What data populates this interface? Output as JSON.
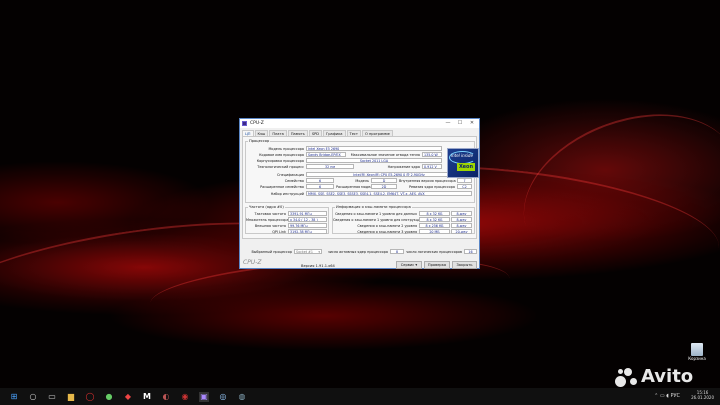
{
  "window": {
    "title": "CPU-Z",
    "controls": [
      "—",
      "☐",
      "✕"
    ],
    "tabs": [
      "ЦП",
      "Кэш",
      "Плата",
      "Память",
      "SPD",
      "Графика",
      "Тест",
      "О программе"
    ],
    "active_tab": "ЦП",
    "processor": {
      "group_label": "Процессор",
      "model_label": "Модель процессора",
      "model": "Intel Xeon E5 2690",
      "codename_label": "Кодовое имя процессора",
      "codename": "Sandy Bridge-EP/EX",
      "tdp_label": "Максимальное значение отвода тепла",
      "tdp": "135.0 W",
      "package_label": "Корпусировка процессора",
      "package": "Socket 2011 LGA",
      "tech_label": "Технологический процесс",
      "tech": "32 нм",
      "voltage_label": "Напряжение ядра",
      "voltage": "0.912 V",
      "spec_label": "Спецификация",
      "spec": "Intel(R) Xeon(R) CPU E5-2690 0 @ 2.90GHz",
      "family_label": "Семейство",
      "family": "6",
      "model_num_label": "Модель",
      "model_num": "D",
      "stepping_label": "Внутренняя версия процессора",
      "stepping": "7",
      "ext_family_label": "Расширенное семейство",
      "ext_family": "6",
      "ext_model_label": "Расширенная модель",
      "ext_model": "2D",
      "revision_label": "Ревизия ядра процессора",
      "revision": "C2",
      "instructions_label": "Набор инструкций",
      "instructions": "MMX, SSE, SSE2, SSE3, SSSE3, SSE4.1, SSE4.2, EM64T, VT-x, AES, AVX",
      "logo_text": "intel inside",
      "logo_brand": "Xeon"
    },
    "clocks": {
      "group_label": "Частота (ядро #0)",
      "core_speed_label": "Тактовая частота",
      "core_speed": "3391.91 МГц",
      "multiplier_label": "Множитель процессора",
      "multiplier": "x 34.0 ( 12 - 38 )",
      "bus_speed_label": "Внешняя частота",
      "bus_speed": "99.76 МГц",
      "qpi_label": "QPI Link",
      "qpi": "3192.38 МГц"
    },
    "cache": {
      "group_label": "Информация о кэш-памяти процессора",
      "rows": [
        {
          "label": "Сведения о кэш-памяти 1 уровня для данных",
          "size": "8 x 32 КБ",
          "assoc": "8-way"
        },
        {
          "label": "Сведения о кэш-памяти 1 уровня для инструкций",
          "size": "8 x 32 КБ",
          "assoc": "8-way"
        },
        {
          "label": "Сведения о кэш-памяти 2 уровня",
          "size": "8 x 256 КБ",
          "assoc": "8-way"
        },
        {
          "label": "Сведения о кэш-памяти 3 уровня",
          "size": "20 МБ",
          "assoc": "20-way"
        }
      ]
    },
    "selection": {
      "selected_label": "Выбранный процессор",
      "selected_value": "Socket #1",
      "cores_label": "число активных ядер процессора",
      "cores": "8",
      "threads_label": "число логических процессоров",
      "threads": "16"
    },
    "footer": {
      "brand": "CPU-Z",
      "version": "Версия 1.91.1.x64",
      "service": "Сервис",
      "validate": "Проверка",
      "close": "Закрыть"
    }
  },
  "desktop": {
    "recycle_bin": "Корзина",
    "watermark": "Avito"
  },
  "taskbar": {
    "language": "РУС",
    "time": "15:16",
    "date": "26.01.2020"
  },
  "colors": {
    "value_text": "#1b2b8f",
    "window_border": "#5a86c6",
    "wallpaper_red": "#c80a0a"
  }
}
